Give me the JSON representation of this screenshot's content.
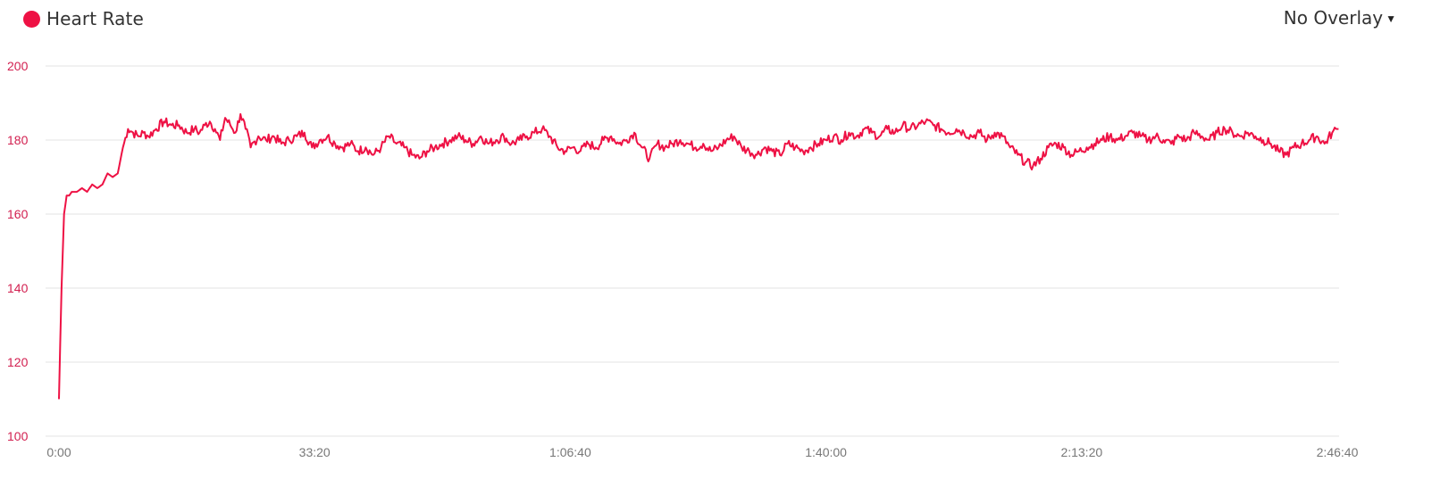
{
  "header": {
    "series_title": "Heart Rate",
    "overlay_label": "No Overlay"
  },
  "colors": {
    "series": "#ee1144",
    "y_tick": "#d22050",
    "grid": "#e3e3e3"
  },
  "chart_data": {
    "type": "line",
    "title": "",
    "xlabel": "",
    "ylabel": "",
    "ylim": [
      100,
      200
    ],
    "xlim_seconds": [
      0,
      10000
    ],
    "yticks": [
      {
        "value": 100,
        "label": "100"
      },
      {
        "value": 120,
        "label": "120"
      },
      {
        "value": 140,
        "label": "140"
      },
      {
        "value": 160,
        "label": "160"
      },
      {
        "value": 180,
        "label": "180"
      },
      {
        "value": 200,
        "label": "200"
      }
    ],
    "xticks": [
      {
        "value": 0,
        "label": "0:00"
      },
      {
        "value": 2000,
        "label": "33:20"
      },
      {
        "value": 4000,
        "label": "1:06:40"
      },
      {
        "value": 6000,
        "label": "1:40:00"
      },
      {
        "value": 8000,
        "label": "2:13:20"
      },
      {
        "value": 10000,
        "label": "2:46:40"
      }
    ],
    "grid": true,
    "legend": "top-left",
    "series": [
      {
        "name": "Heart Rate",
        "x": [
          0,
          20,
          40,
          60,
          80,
          100,
          140,
          180,
          220,
          260,
          300,
          340,
          380,
          420,
          460,
          500,
          540,
          580,
          620,
          660,
          700,
          760,
          820,
          880,
          940,
          1000,
          1060,
          1100,
          1140,
          1180,
          1220,
          1260,
          1300,
          1340,
          1380,
          1420,
          1460,
          1500,
          1560,
          1620,
          1680,
          1740,
          1800,
          1860,
          1920,
          1980,
          2040,
          2100,
          2160,
          2220,
          2280,
          2340,
          2400,
          2460,
          2520,
          2580,
          2640,
          2700,
          2760,
          2820,
          2880,
          2940,
          3000,
          3060,
          3120,
          3180,
          3240,
          3300,
          3360,
          3420,
          3480,
          3540,
          3600,
          3660,
          3720,
          3780,
          3840,
          3900,
          3960,
          4020,
          4080,
          4140,
          4200,
          4260,
          4320,
          4380,
          4440,
          4500,
          4560,
          4620,
          4680,
          4740,
          4800,
          4860,
          4920,
          4980,
          5040,
          5100,
          5160,
          5220,
          5280,
          5340,
          5400,
          5460,
          5520,
          5580,
          5640,
          5700,
          5760,
          5820,
          5880,
          5940,
          6000,
          6060,
          6120,
          6180,
          6240,
          6300,
          6360,
          6420,
          6480,
          6540,
          6600,
          6660,
          6720,
          6780,
          6840,
          6900,
          6960,
          7020,
          7080,
          7140,
          7200,
          7260,
          7320,
          7380,
          7440,
          7500,
          7560,
          7620,
          7680,
          7740,
          7800,
          7860,
          7920,
          7980,
          8040,
          8100,
          8160,
          8220,
          8280,
          8340,
          8400,
          8460,
          8520,
          8580,
          8640,
          8700,
          8760,
          8820,
          8880,
          8940,
          9000,
          9060,
          9120,
          9180,
          9240,
          9300,
          9360,
          9420,
          9480,
          9540,
          9600,
          9660,
          9720,
          9780,
          9840,
          9900,
          9960,
          10000,
          10010
        ],
        "y": [
          110,
          140,
          160,
          165,
          165,
          166,
          166,
          167,
          166,
          168,
          167,
          168,
          171,
          170,
          171,
          178,
          183,
          182,
          181,
          182,
          181,
          183,
          185,
          184,
          184,
          182,
          183,
          182,
          184,
          185,
          183,
          180,
          186,
          184,
          182,
          187,
          183,
          178,
          181,
          180,
          181,
          179,
          180,
          181,
          182,
          178,
          180,
          181,
          179,
          178,
          179,
          177,
          178,
          176,
          178,
          181,
          179,
          178,
          176,
          175,
          177,
          178,
          179,
          180,
          181,
          180,
          179,
          181,
          179,
          180,
          181,
          179,
          180,
          181,
          182,
          183,
          181,
          178,
          177,
          178,
          177,
          179,
          178,
          180,
          181,
          179,
          180,
          182,
          178,
          175,
          179,
          178,
          179,
          180,
          179,
          178,
          179,
          177,
          178,
          180,
          181,
          178,
          177,
          176,
          178,
          177,
          176,
          179,
          178,
          177,
          178,
          179,
          180,
          181,
          180,
          182,
          181,
          183,
          182,
          181,
          183,
          182,
          184,
          183,
          184,
          185,
          184,
          183,
          182,
          183,
          182,
          181,
          182,
          180,
          182,
          181,
          178,
          176,
          174,
          173,
          175,
          178,
          179,
          178,
          176,
          177,
          178,
          179,
          180,
          181,
          180,
          181,
          182,
          181,
          180,
          181,
          180,
          179,
          181,
          180,
          182,
          181,
          180,
          182,
          183,
          182,
          181,
          182,
          181,
          180,
          179,
          177,
          176,
          178,
          179,
          180,
          181,
          179,
          182,
          183,
          183
        ]
      }
    ]
  }
}
